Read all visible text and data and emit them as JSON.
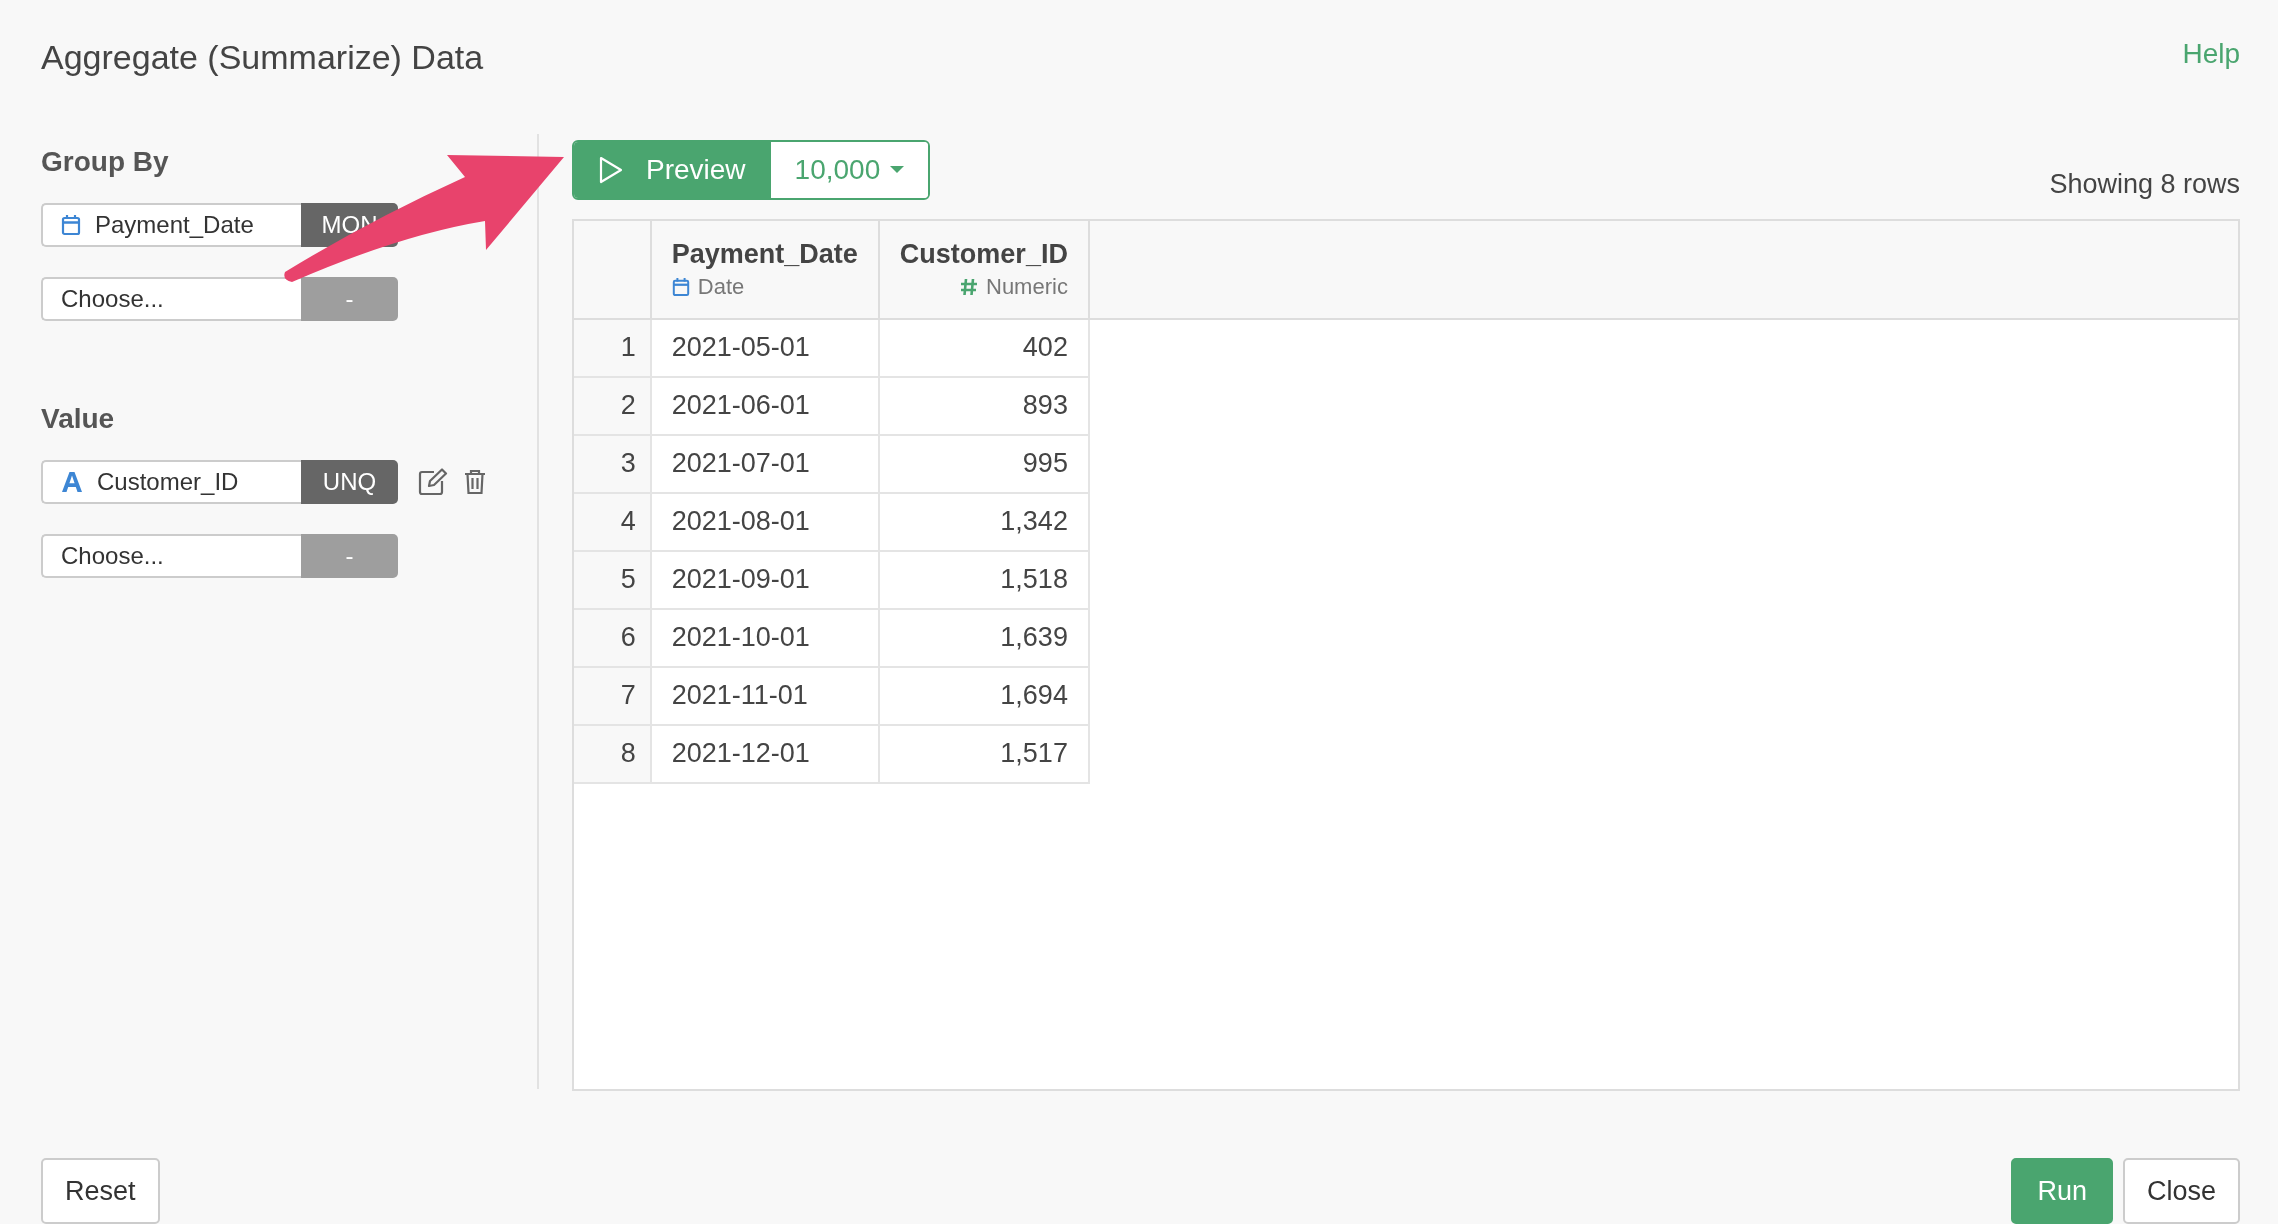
{
  "dialog": {
    "title": "Aggregate (Summarize) Data",
    "help": "Help"
  },
  "group_by": {
    "label": "Group By",
    "fields": [
      {
        "kind": "date",
        "value": "Payment_Date",
        "tag": "MON",
        "actions": false
      },
      {
        "kind": "empty",
        "value": "Choose...",
        "tag": "-",
        "actions": false
      }
    ]
  },
  "value": {
    "label": "Value",
    "fields": [
      {
        "kind": "text",
        "value": "Customer_ID",
        "tag": "UNQ",
        "actions": true
      },
      {
        "kind": "empty",
        "value": "Choose...",
        "tag": "-",
        "actions": false
      }
    ]
  },
  "preview": {
    "label": "Preview",
    "limit": "10,000",
    "status": "Showing 8 rows"
  },
  "table": {
    "columns": [
      {
        "name": "Payment_Date",
        "kind": "date",
        "type": "Date"
      },
      {
        "name": "Customer_ID",
        "kind": "numeric",
        "type": "Numeric"
      }
    ],
    "rows": [
      {
        "index": "1",
        "cells": [
          "2021-05-01",
          "402"
        ]
      },
      {
        "index": "2",
        "cells": [
          "2021-06-01",
          "893"
        ]
      },
      {
        "index": "3",
        "cells": [
          "2021-07-01",
          "995"
        ]
      },
      {
        "index": "4",
        "cells": [
          "2021-08-01",
          "1,342"
        ]
      },
      {
        "index": "5",
        "cells": [
          "2021-09-01",
          "1,518"
        ]
      },
      {
        "index": "6",
        "cells": [
          "2021-10-01",
          "1,639"
        ]
      },
      {
        "index": "7",
        "cells": [
          "2021-11-01",
          "1,694"
        ]
      },
      {
        "index": "8",
        "cells": [
          "2021-12-01",
          "1,517"
        ]
      }
    ]
  },
  "footer": {
    "buttons": [
      {
        "kind": "reset",
        "label": "Reset"
      },
      {
        "kind": "primary",
        "label": "Run"
      },
      {
        "kind": "default",
        "label": "Close"
      }
    ]
  }
}
